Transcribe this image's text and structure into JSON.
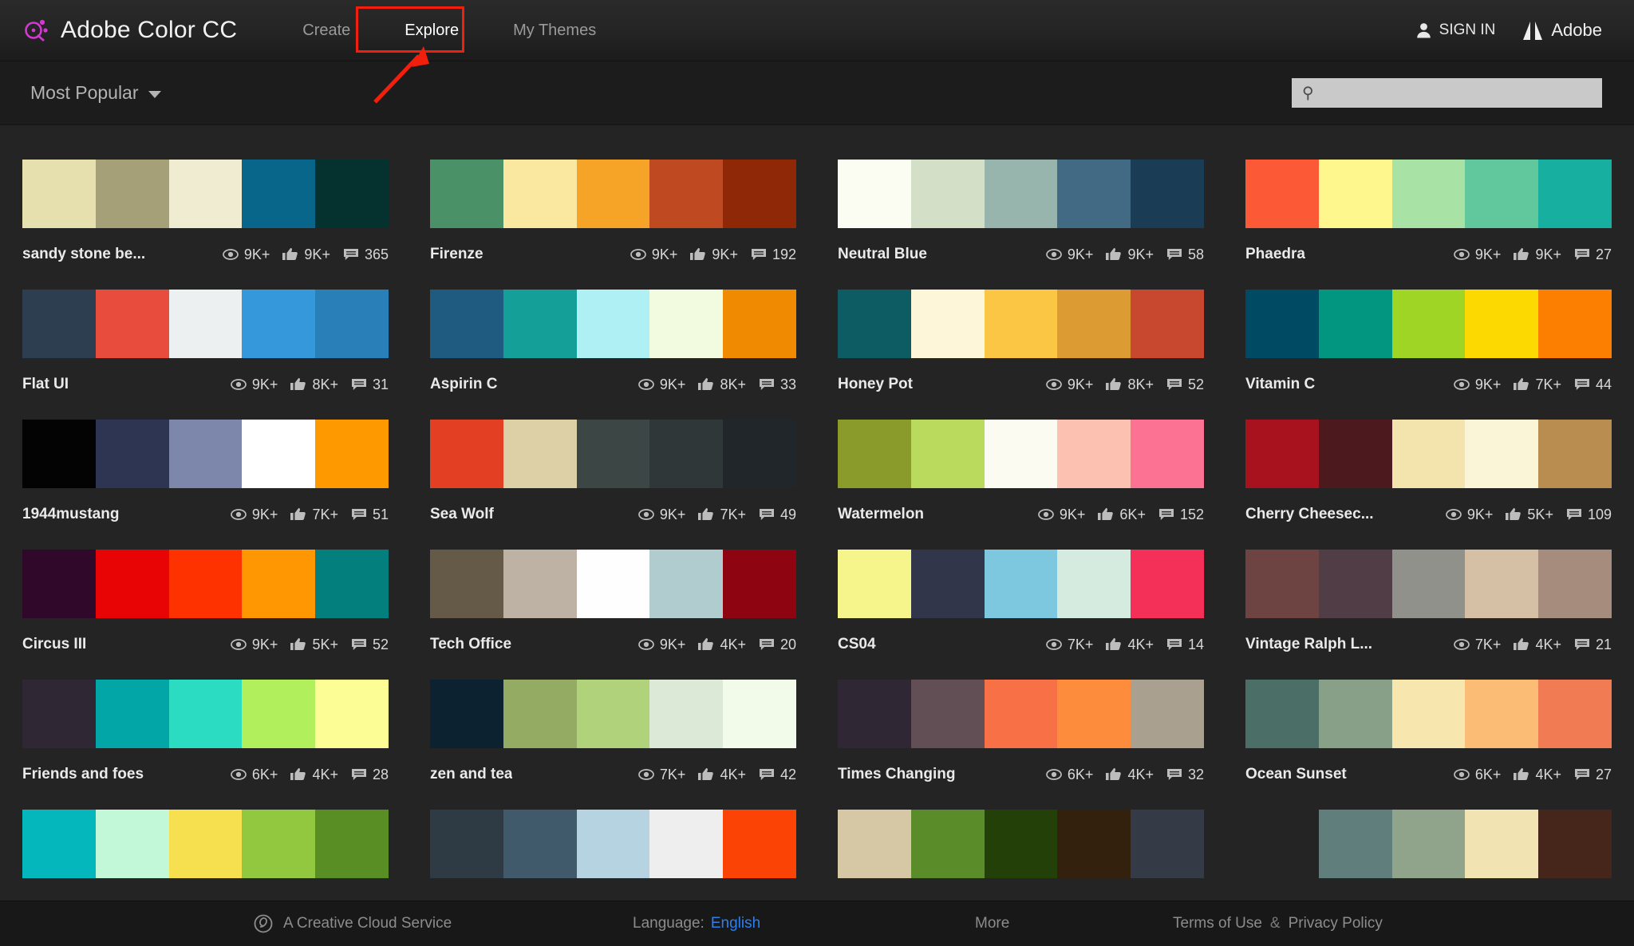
{
  "header": {
    "brand_title": "Adobe Color CC",
    "logo_icon": "adobe-color-logo-icon",
    "nav": [
      {
        "label": "Create",
        "active": false
      },
      {
        "label": "Explore",
        "active": true
      },
      {
        "label": "My Themes",
        "active": false
      }
    ],
    "sign_in_label": "SIGN IN",
    "sign_in_icon": "person-icon",
    "adobe_label": "Adobe",
    "adobe_icon": "adobe-a-logo-icon"
  },
  "annotation": {
    "target_label": "Explore",
    "box_color": "#f21f0c",
    "arrow_color": "#f21f0c"
  },
  "subbar": {
    "sort_label": "Most Popular",
    "sort_caret_icon": "chevron-down-icon",
    "search_placeholder": "",
    "search_value": "",
    "search_icon": "search-icon"
  },
  "stats_icons": {
    "views": "eye-icon",
    "likes": "thumbs-up-icon",
    "comments": "comment-bubble-icon"
  },
  "themes": [
    {
      "name": "sandy stone be...",
      "views": "9K+",
      "likes": "9K+",
      "comments": "365",
      "colors": [
        "#e5e0ae",
        "#a6a079",
        "#f0ecd2",
        "#076689",
        "#05312f"
      ]
    },
    {
      "name": "Firenze",
      "views": "9K+",
      "likes": "9K+",
      "comments": "192",
      "colors": [
        "#4a9168",
        "#fbe8a0",
        "#f6a428",
        "#bf4a22",
        "#8f2806"
      ]
    },
    {
      "name": "Neutral Blue",
      "views": "9K+",
      "likes": "9K+",
      "comments": "58",
      "colors": [
        "#fbfdf2",
        "#d4dfc7",
        "#97b5ad",
        "#426a84",
        "#1a3c54"
      ]
    },
    {
      "name": "Phaedra",
      "views": "9K+",
      "likes": "9K+",
      "comments": "27",
      "colors": [
        "#fc5a37",
        "#fdf78e",
        "#a9e2a5",
        "#60c89c",
        "#17b0a0"
      ]
    },
    {
      "name": "Flat UI",
      "views": "9K+",
      "likes": "8K+",
      "comments": "31",
      "colors": [
        "#2c3e50",
        "#e74c3c",
        "#ecf0f1",
        "#3498db",
        "#2980b9"
      ]
    },
    {
      "name": "Aspirin C",
      "views": "9K+",
      "likes": "8K+",
      "comments": "33",
      "colors": [
        "#1f5b81",
        "#14a098",
        "#aef0f4",
        "#f2fae0",
        "#f08a00"
      ]
    },
    {
      "name": "Honey Pot",
      "views": "9K+",
      "likes": "8K+",
      "comments": "52",
      "colors": [
        "#0d5c63",
        "#fdf6d8",
        "#fbc643",
        "#dd9b33",
        "#c8472f"
      ]
    },
    {
      "name": "Vitamin C",
      "views": "9K+",
      "likes": "7K+",
      "comments": "44",
      "colors": [
        "#014a63",
        "#02957f",
        "#9fd626",
        "#fbd901",
        "#fc7f02"
      ]
    },
    {
      "name": "1944mustang",
      "views": "9K+",
      "likes": "7K+",
      "comments": "51",
      "colors": [
        "#030303",
        "#2e3552",
        "#7c87ab",
        "#ffffff",
        "#fe9900"
      ]
    },
    {
      "name": "Sea Wolf",
      "views": "9K+",
      "likes": "7K+",
      "comments": "49",
      "colors": [
        "#e33f22",
        "#ddd0a6",
        "#3c4745",
        "#2f3739",
        "#20262a"
      ]
    },
    {
      "name": "Watermelon",
      "views": "9K+",
      "likes": "6K+",
      "comments": "152",
      "colors": [
        "#8b9b2b",
        "#bada5e",
        "#fcfbf2",
        "#fdc1b2",
        "#fc7292"
      ]
    },
    {
      "name": "Cherry Cheesec...",
      "views": "9K+",
      "likes": "5K+",
      "comments": "109",
      "colors": [
        "#a8121f",
        "#4c1a1e",
        "#f2e4ac",
        "#faf5d6",
        "#b98c4f"
      ]
    },
    {
      "name": "Circus III",
      "views": "9K+",
      "likes": "5K+",
      "comments": "52",
      "colors": [
        "#30092a",
        "#e80404",
        "#fe3100",
        "#fe9701",
        "#03807e"
      ]
    },
    {
      "name": "Tech Office",
      "views": "9K+",
      "likes": "4K+",
      "comments": "20",
      "colors": [
        "#645a47",
        "#bdb2a3",
        "#fefefe",
        "#b0ccce",
        "#8e0511"
      ]
    },
    {
      "name": "CS04",
      "views": "7K+",
      "likes": "4K+",
      "comments": "14",
      "colors": [
        "#f5f58b",
        "#32364b",
        "#7ec8df",
        "#d6ebe0",
        "#f43058"
      ]
    },
    {
      "name": "Vintage Ralph L...",
      "views": "7K+",
      "likes": "4K+",
      "comments": "21",
      "colors": [
        "#6e4442",
        "#513d46",
        "#91918c",
        "#d5c0a5",
        "#a58c7c"
      ]
    },
    {
      "name": "Friends and foes",
      "views": "6K+",
      "likes": "4K+",
      "comments": "28",
      "colors": [
        "#2f2733",
        "#03a6a7",
        "#2bdcc2",
        "#b2ef5c",
        "#fdfd96"
      ]
    },
    {
      "name": "zen and tea",
      "views": "7K+",
      "likes": "4K+",
      "comments": "42",
      "colors": [
        "#0c2231",
        "#93ab62",
        "#b0d27a",
        "#dde9d7",
        "#f2faea"
      ]
    },
    {
      "name": "Times Changing",
      "views": "6K+",
      "likes": "4K+",
      "comments": "32",
      "colors": [
        "#2f2733",
        "#624f56",
        "#f87045",
        "#fd8c3d",
        "#aaa090"
      ]
    },
    {
      "name": "Ocean Sunset",
      "views": "6K+",
      "likes": "4K+",
      "comments": "27",
      "colors": [
        "#4b6e67",
        "#87a087",
        "#f7e6ae",
        "#fbbd75",
        "#f17b52"
      ]
    },
    {
      "name": "",
      "views": "",
      "likes": "",
      "comments": "",
      "colors": [
        "#04b7bd",
        "#c2f7d7",
        "#f7e04f",
        "#92c740",
        "#588e24"
      ]
    },
    {
      "name": "",
      "views": "",
      "likes": "",
      "comments": "",
      "colors": [
        "#2e3b44",
        "#415a6b",
        "#b5d3e0",
        "#eeeeee",
        "#fb4305"
      ]
    },
    {
      "name": "",
      "views": "",
      "likes": "",
      "comments": "",
      "colors": [
        "#d6c8a4",
        "#5b8c2a",
        "#224008",
        "#34210d",
        "#353a47"
      ]
    },
    {
      "name": "",
      "views": "",
      "likes": "",
      "comments": "",
      "colors": [
        "#242424",
        "#5f7e7c",
        "#8fa48b",
        "#f2e3b3",
        "#46251b"
      ]
    }
  ],
  "footer": {
    "cc_icon": "creative-cloud-icon",
    "cc_label": "A Creative Cloud Service",
    "language_label": "Language:",
    "language_value": "English",
    "more_label": "More",
    "terms_label": "Terms of Use",
    "amp": "&",
    "privacy_label": "Privacy Policy"
  }
}
